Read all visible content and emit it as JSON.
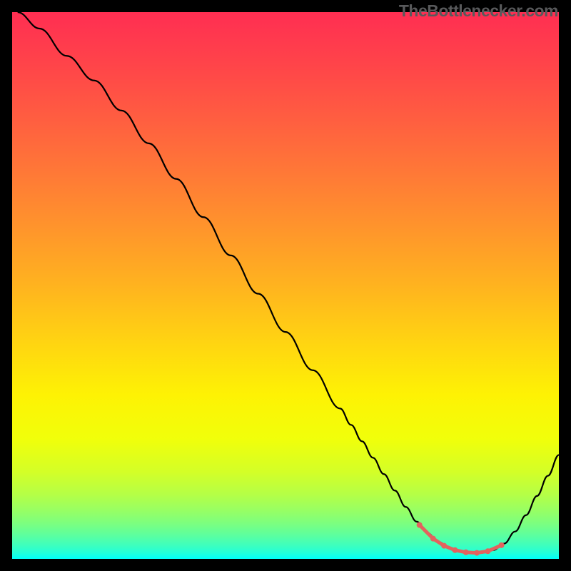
{
  "watermark": "TheBottlenecker.com",
  "chart_data": {
    "type": "line",
    "title": "",
    "xlabel": "",
    "ylabel": "",
    "xlim": [
      0,
      100
    ],
    "ylim": [
      0,
      100
    ],
    "background_gradient": {
      "stops": [
        {
          "offset": 0.0,
          "color": "#ff2e52"
        },
        {
          "offset": 0.1,
          "color": "#ff4549"
        },
        {
          "offset": 0.2,
          "color": "#ff5f40"
        },
        {
          "offset": 0.3,
          "color": "#ff7a36"
        },
        {
          "offset": 0.4,
          "color": "#ff962b"
        },
        {
          "offset": 0.5,
          "color": "#ffb31f"
        },
        {
          "offset": 0.6,
          "color": "#ffd312"
        },
        {
          "offset": 0.7,
          "color": "#fef204"
        },
        {
          "offset": 0.78,
          "color": "#f1ff0a"
        },
        {
          "offset": 0.84,
          "color": "#d4ff27"
        },
        {
          "offset": 0.88,
          "color": "#b7ff44"
        },
        {
          "offset": 0.91,
          "color": "#99ff62"
        },
        {
          "offset": 0.935,
          "color": "#7cff7f"
        },
        {
          "offset": 0.955,
          "color": "#5fff9c"
        },
        {
          "offset": 0.975,
          "color": "#3effbd"
        },
        {
          "offset": 0.99,
          "color": "#20ffdb"
        },
        {
          "offset": 1.0,
          "color": "#00fffa"
        }
      ]
    },
    "series": [
      {
        "name": "bottleneck-curve",
        "color": "#000000",
        "x": [
          1,
          5,
          10,
          15,
          20,
          25,
          30,
          35,
          40,
          45,
          50,
          55,
          60,
          62,
          64,
          66,
          68,
          70,
          72,
          74,
          76,
          78,
          80,
          82,
          84,
          86,
          88,
          90,
          92,
          94,
          96,
          98,
          100
        ],
        "y": [
          100,
          97,
          92,
          87.5,
          82,
          76,
          69.5,
          62.5,
          55.5,
          48.5,
          41.5,
          34.5,
          27.5,
          24.5,
          21.5,
          18.5,
          15.5,
          12.5,
          9.5,
          6.8,
          4.7,
          3.1,
          2.0,
          1.4,
          1.1,
          1.1,
          1.6,
          2.8,
          5.0,
          8.0,
          11.5,
          15.2,
          19
        ]
      }
    ],
    "highlight_segment": {
      "name": "recommended-range",
      "color": "#e3625e",
      "dot_radius": 4,
      "line_width": 5,
      "points_x": [
        74.5,
        77,
        79,
        81,
        83,
        85,
        87,
        89.5
      ],
      "points_y": [
        6.2,
        3.7,
        2.4,
        1.6,
        1.2,
        1.1,
        1.4,
        2.5
      ]
    }
  }
}
